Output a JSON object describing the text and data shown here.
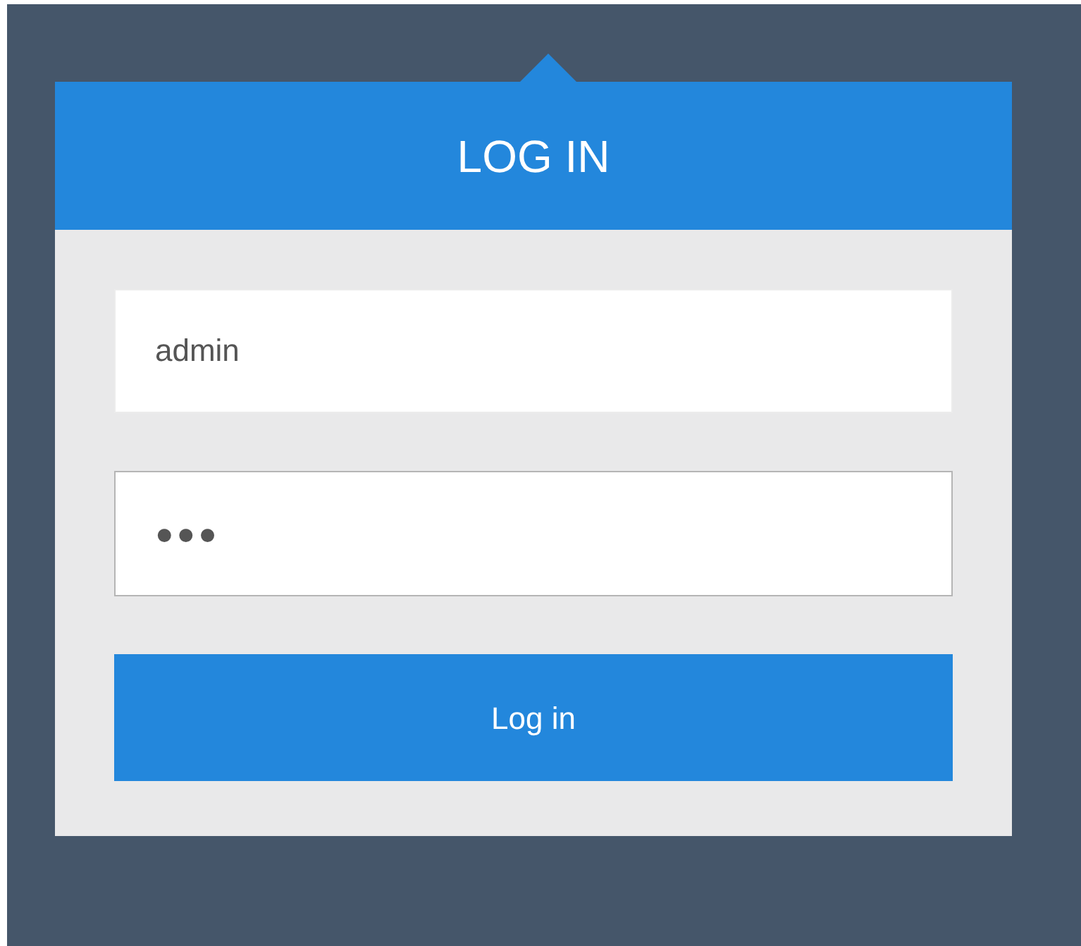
{
  "title": "LOG IN",
  "fields": [
    {
      "kind": "text",
      "value": "admin"
    },
    {
      "kind": "password",
      "value": "●●●"
    }
  ],
  "button": "Log in"
}
